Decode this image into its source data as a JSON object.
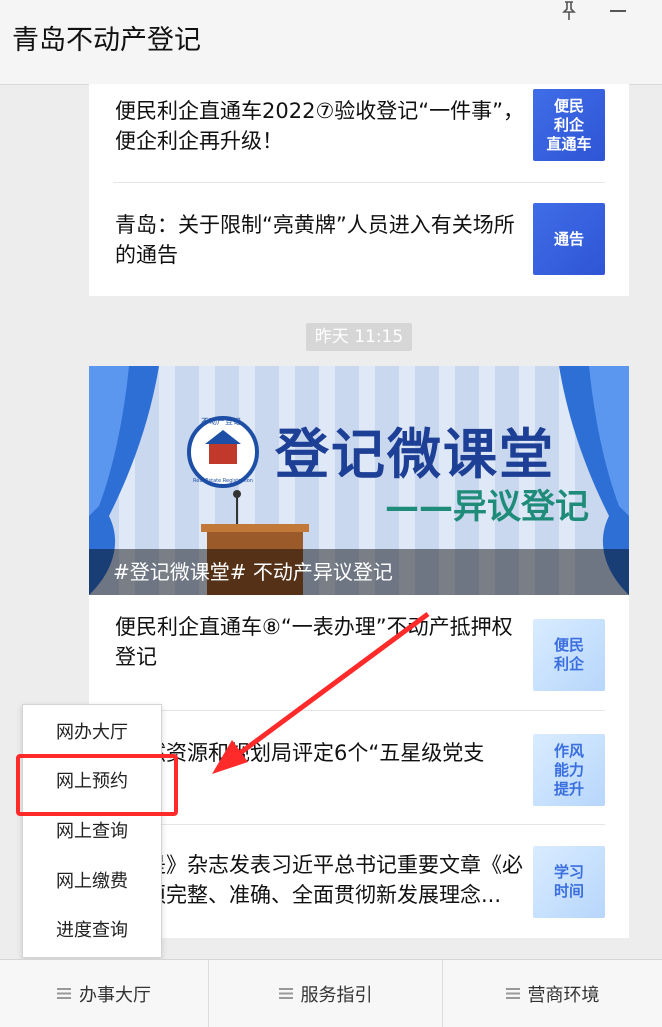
{
  "window": {
    "title": "青岛不动产登记"
  },
  "articles_top": [
    {
      "title": "便民利企直通车2022⑦验收登记“一件事”，便企利企再升级！",
      "thumb_text": "便民\n利企\n直通车"
    },
    {
      "title": "青岛：关于限制“亮黄牌”人员进入有关场所的通告",
      "thumb_text": "通告"
    }
  ],
  "timestamp": "昨天  11:15",
  "banner": {
    "headline": "登记微课堂",
    "subhead": "——异议登记",
    "logo_top": "不动产登记",
    "logo_bottom": "Real Estate Registration",
    "caption": "#登记微课堂# 不动产异议登记"
  },
  "articles_bottom": [
    {
      "title": "便民利企直通车⑧“一表办理”不动产抵押权登记",
      "thumb_text": "便民\n利企"
    },
    {
      "title": "然资源和规划局评定6个“五星级党支",
      "thumb_text": "作风\n能力\n提升"
    },
    {
      "title": "是》杂志发表习近平总书记重要文章《必须完整、准确、全面贯彻新发展理念...",
      "thumb_text": "学习\n时间"
    }
  ],
  "popup_menu": {
    "items": [
      "网办大厅",
      "网上预约",
      "网上查询",
      "网上缴费",
      "进度查询"
    ],
    "highlighted": "网上预约"
  },
  "tabbar": {
    "items": [
      "办事大厅",
      "服务指引",
      "营商环境"
    ]
  },
  "colors": {
    "highlight": "#ff2b2b",
    "thumb_blue": "#3f6de8",
    "annotation_arrow": "#ff2b2b"
  }
}
